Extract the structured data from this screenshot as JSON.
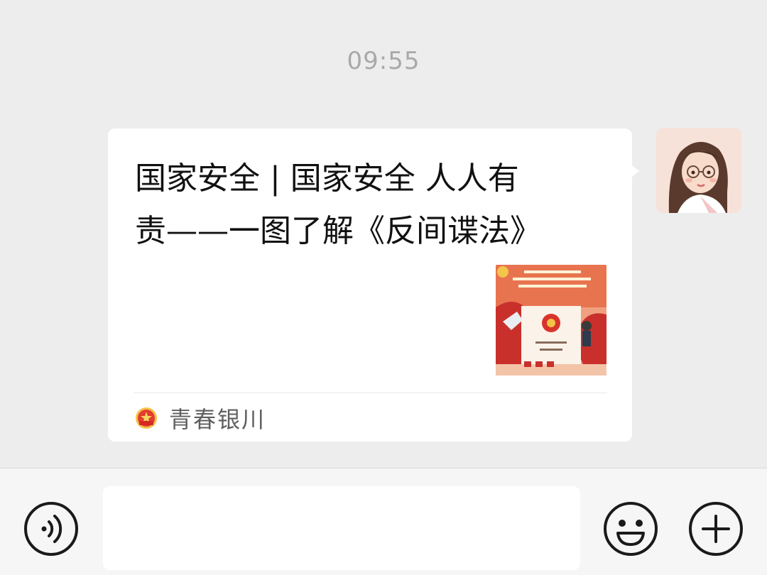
{
  "chat": {
    "timestamp": "09:55"
  },
  "message": {
    "title_line1": "国家安全 | 国家安全 人人有",
    "title_line2": "责——一图了解《反间谍法》",
    "thumbnail_icon": "poster-thumbnail",
    "source": {
      "name": "青春银川",
      "logo_icon": "youth-league-emblem-icon"
    }
  },
  "sender": {
    "avatar_icon": "cartoon-girl-avatar"
  },
  "input_bar": {
    "voice_icon": "voice-input-icon",
    "emoji_icon": "emoji-smile-icon",
    "plus_icon": "plus-circle-icon",
    "text_value": ""
  },
  "colors": {
    "background": "#ededed",
    "bubble": "#ffffff",
    "input_bar": "#f6f6f6",
    "text_primary": "#111111",
    "text_secondary": "#5f5f5f",
    "timestamp": "#a9a9a9",
    "thumbnail_red": "#d8432f"
  }
}
